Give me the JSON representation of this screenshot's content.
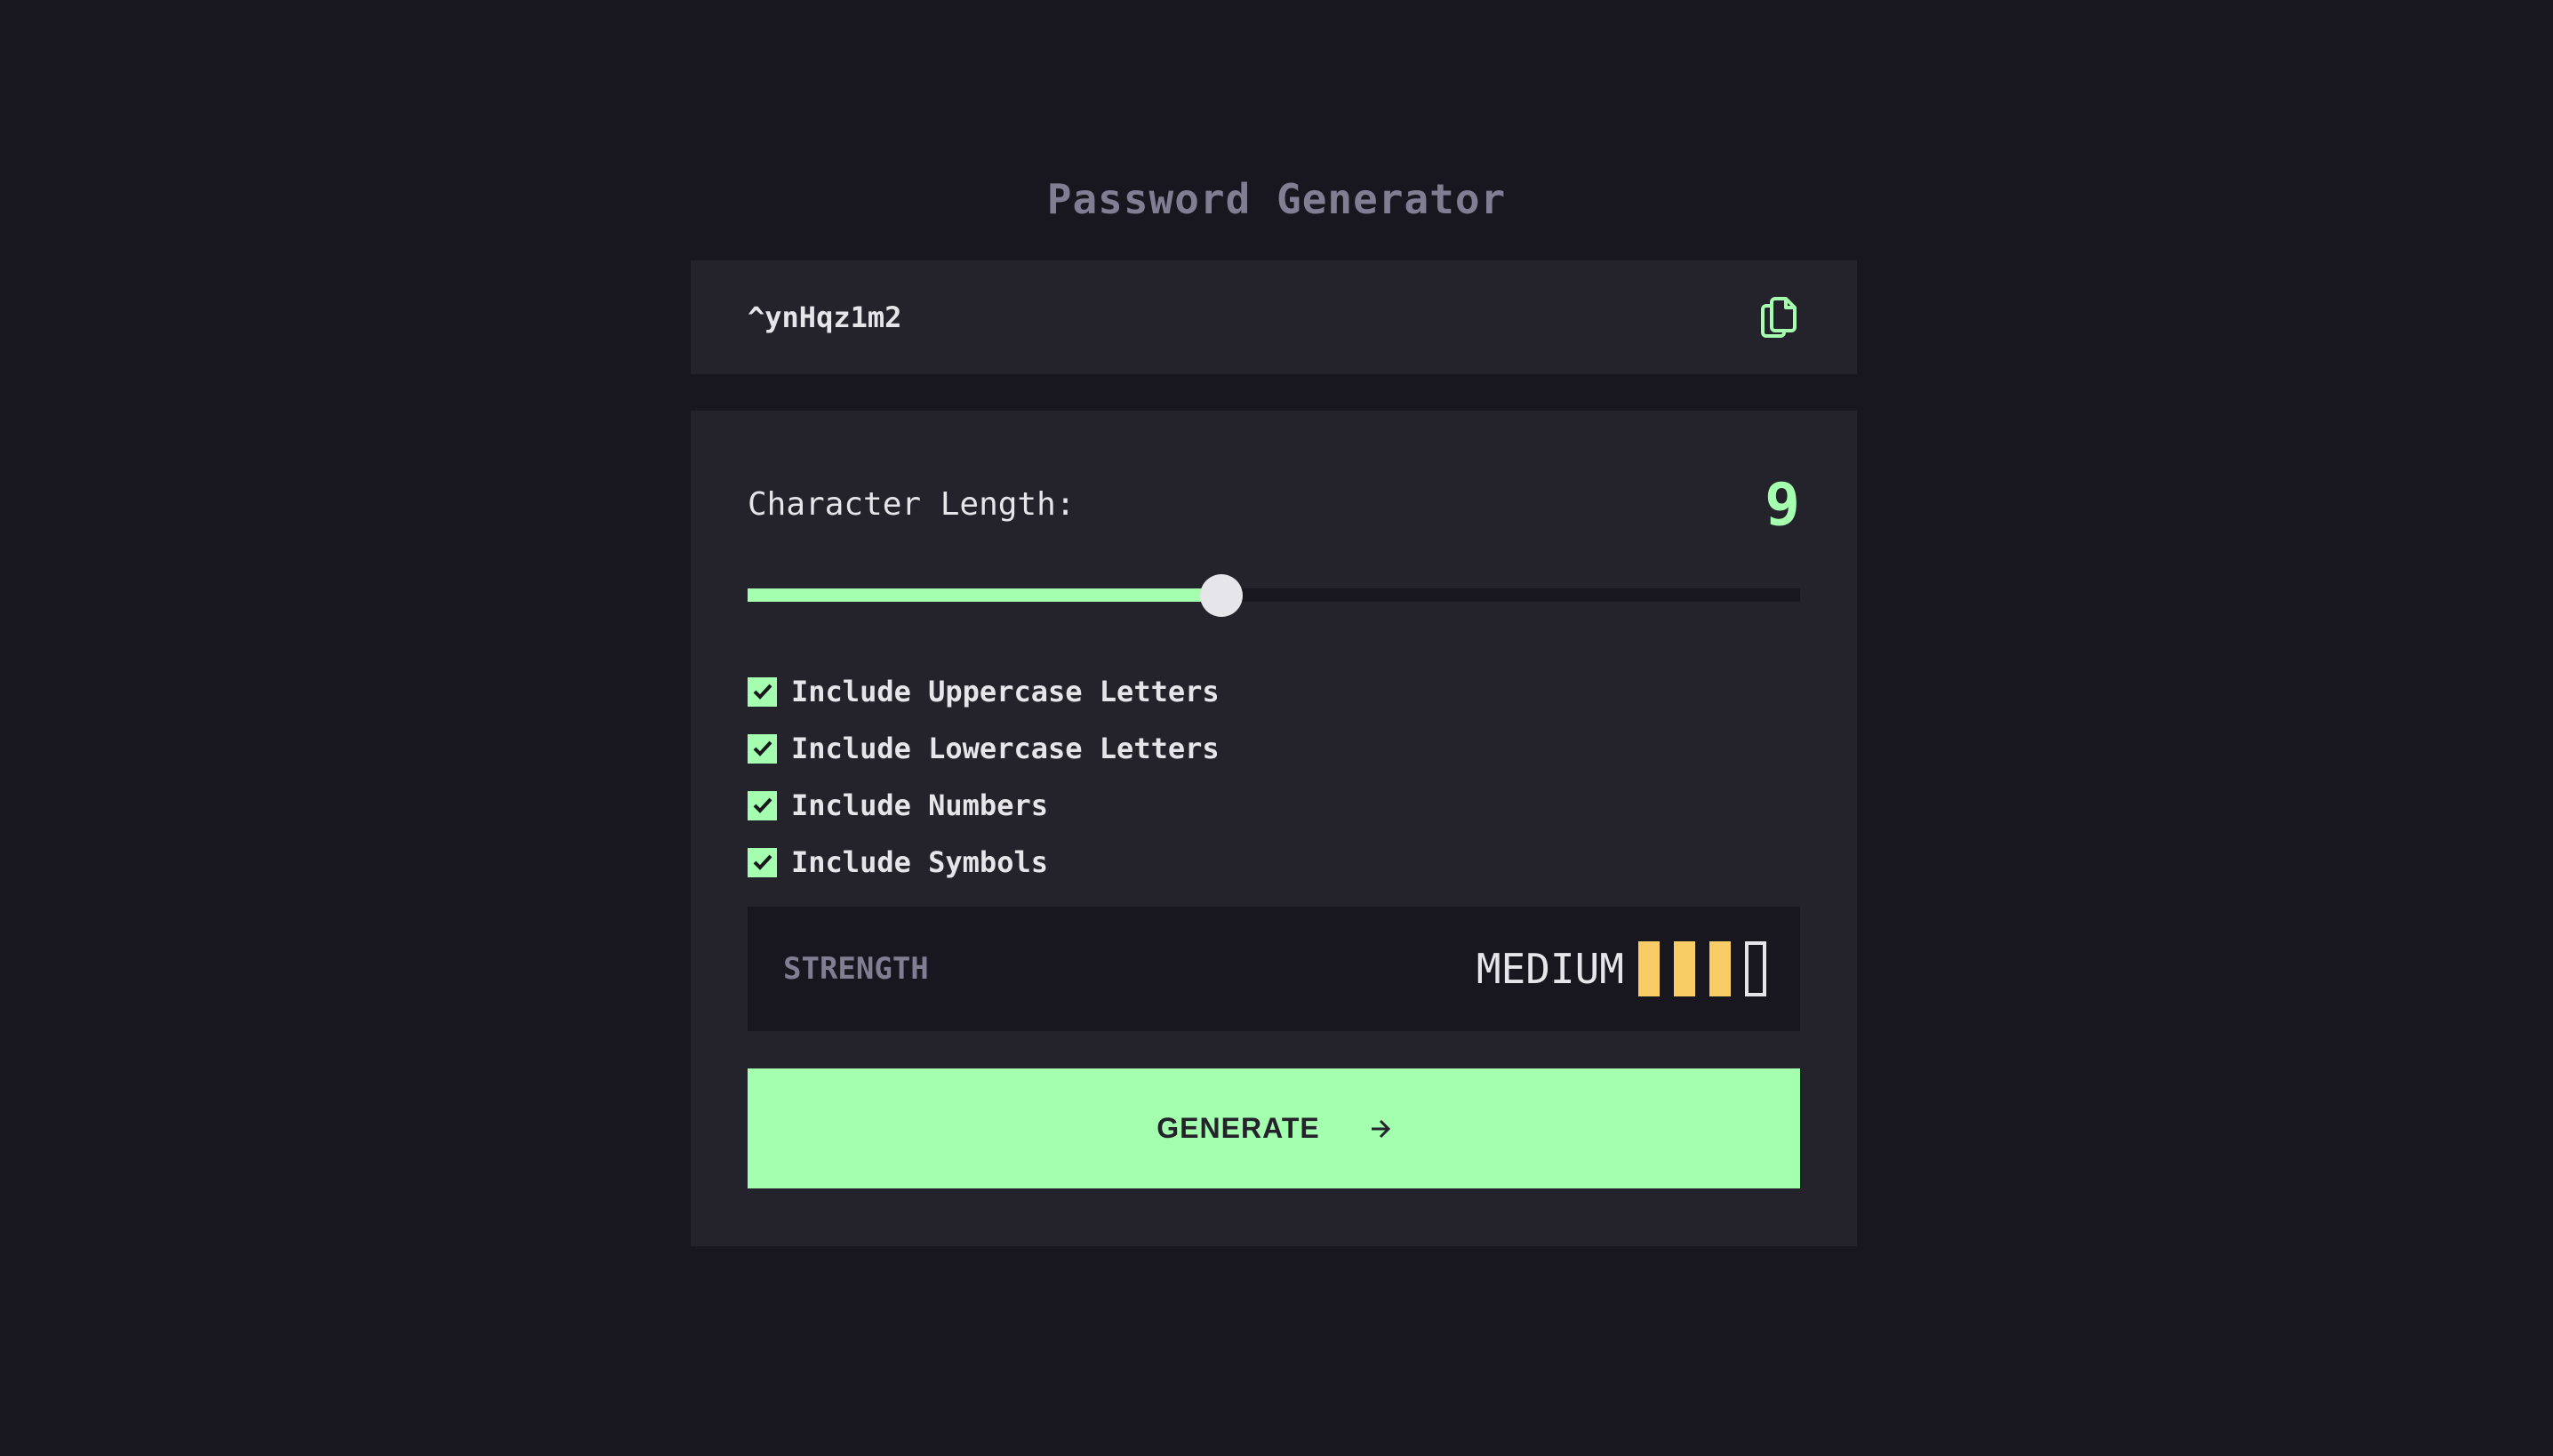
{
  "app": {
    "title": "Password Generator"
  },
  "password": {
    "value": "^ynHqz1m2",
    "copy_icon": "copy-icon"
  },
  "length": {
    "label": "Character Length:",
    "value": "9",
    "current": 9,
    "min": 0,
    "max": 20
  },
  "options": [
    {
      "label": "Include Uppercase Letters",
      "checked": true
    },
    {
      "label": "Include Lowercase Letters",
      "checked": true
    },
    {
      "label": "Include Numbers",
      "checked": true
    },
    {
      "label": "Include Symbols",
      "checked": true
    }
  ],
  "strength": {
    "label": "STRENGTH",
    "level": "MEDIUM",
    "bars_filled": 3,
    "bars_total": 4
  },
  "generate": {
    "label": "GENERATE",
    "icon": "arrow-right-icon"
  },
  "colors": {
    "accent": "#a4ffaf",
    "medium": "#f8cd65",
    "background": "#18171f",
    "card": "#24232c",
    "muted": "#817d92",
    "text": "#e6e5ea"
  }
}
